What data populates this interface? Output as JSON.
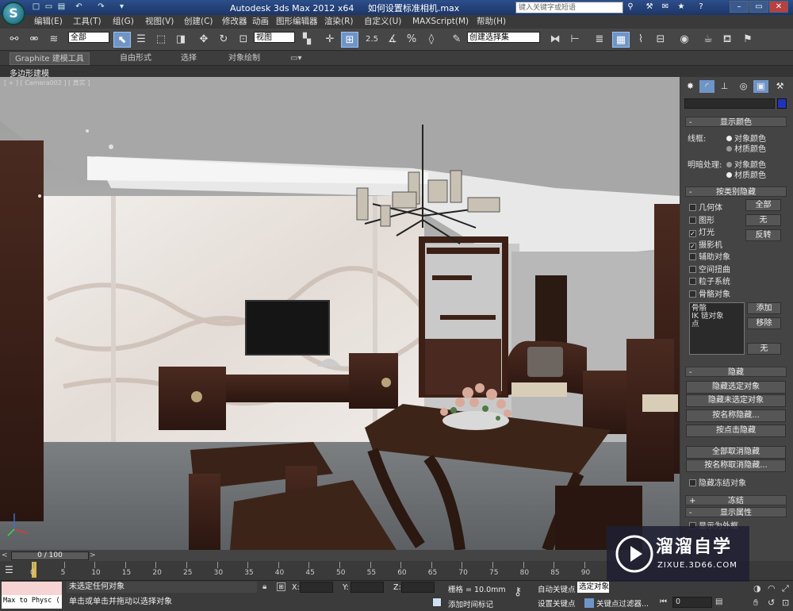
{
  "titlebar": {
    "app_title": "Autodesk 3ds Max  2012 x64",
    "file_name": "如何设置标准相机.max",
    "search_placeholder": "键入关键字或短语",
    "logo_letter": "S"
  },
  "menu": [
    "编辑(E)",
    "工具(T)",
    "组(G)",
    "视图(V)",
    "创建(C)",
    "修改器",
    "动画",
    "图形编辑器",
    "渲染(R)",
    "自定义(U)",
    "MAXScript(M)",
    "帮助(H)"
  ],
  "toolbar": {
    "selection_filter": "全部",
    "reference_coord": "视图",
    "named_selection": "创建选择集",
    "snap_angle": "2.5"
  },
  "ribbon": {
    "tabs": [
      "Graphite 建模工具",
      "自由形式",
      "选择",
      "对象绘制"
    ],
    "sub_label": "多边形建模"
  },
  "viewport": {
    "label": "[ + ] [ Camera002 ] [ 真实 ]"
  },
  "cmdpanel": {
    "name_value": "",
    "display_color": {
      "title": "显示颜色",
      "wireframe_label": "线框:",
      "shaded_label": "明暗处理:",
      "opt_object": "对象颜色",
      "opt_material": "材质颜色"
    },
    "hide_by_category": {
      "title": "按类别隐藏",
      "items": [
        {
          "label": "几何体",
          "checked": false
        },
        {
          "label": "图形",
          "checked": false
        },
        {
          "label": "灯光",
          "checked": true
        },
        {
          "label": "摄影机",
          "checked": true
        },
        {
          "label": "辅助对象",
          "checked": false
        },
        {
          "label": "空间扭曲",
          "checked": false
        },
        {
          "label": "粒子系统",
          "checked": false
        },
        {
          "label": "骨骼对象",
          "checked": false
        }
      ],
      "btn_all": "全部",
      "btn_none": "无",
      "btn_invert": "反转",
      "list_items": [
        "骨骼",
        "IK 链对象",
        "点"
      ],
      "btn_add": "添加",
      "btn_remove": "移除",
      "btn_none2": "无"
    },
    "hide": {
      "title": "隐藏",
      "buttons": [
        "隐藏选定对象",
        "隐藏未选定对象",
        "按名称隐藏...",
        "按点击隐藏",
        "全部取消隐藏",
        "按名称取消隐藏...",
        "隐藏冻结对象"
      ]
    },
    "freeze": {
      "title": "冻结"
    },
    "display_props": {
      "title": "显示属性",
      "first_item": "显示为外框"
    }
  },
  "timeline": {
    "frame_display": "0 / 100",
    "ticks": [
      "0",
      "5",
      "10",
      "15",
      "20",
      "25",
      "30",
      "35",
      "40",
      "45",
      "50",
      "55",
      "60",
      "65",
      "70",
      "75",
      "80",
      "85",
      "90"
    ]
  },
  "status": {
    "script_listener": "Max to Physc (",
    "selection_status": "未选定任何对象",
    "prompt": "单击或单击并拖动以选择对象",
    "x_label": "X:",
    "y_label": "Y:",
    "z_label": "Z:",
    "grid": "栅格 = 10.0mm",
    "add_time_tag": "添加时间标记",
    "auto_key": "自动关键点",
    "set_key": "设置关键点",
    "selected_obj": "选定对象",
    "key_filters": "关键点过滤器...",
    "frame_value": "0"
  },
  "watermark": {
    "brand": "溜溜自学",
    "url": "ZIXUE.3D66.COM"
  },
  "colors": {
    "accent": "#6f95c7",
    "titlebar": "#2c4e8a"
  }
}
